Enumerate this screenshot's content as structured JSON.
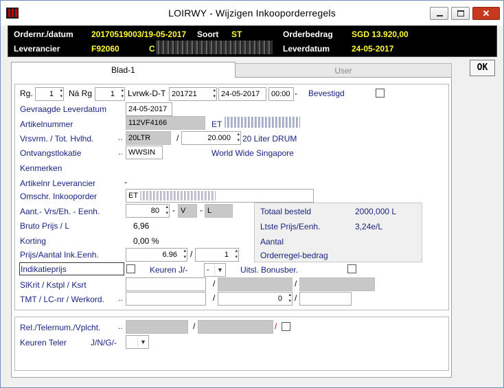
{
  "window": {
    "title": "LOIRWY - Wijzigen Inkooporderregels"
  },
  "header": {
    "order_label": "Ordernr./datum",
    "order_value": "20170519003/19-05-2017",
    "soort_label": "Soort",
    "soort_value": "ST",
    "bedrag_label": "Orderbedrag",
    "bedrag_value": "SGD 13.920,00",
    "lev_label": "Leverancier",
    "lev_value": "F92060",
    "lev_name": "C",
    "leverdatum_label": "Leverdatum",
    "leverdatum_value": "24-05-2017"
  },
  "ok_label": "OK",
  "tabs": [
    {
      "label": "Blad-1"
    },
    {
      "label": "User"
    }
  ],
  "form": {
    "rg_label": "Rg.",
    "rg_value": "1",
    "na_rg_label": "Ná Rg",
    "na_rg_value": "1",
    "lvrwk_label": "Lvrwk-D-T",
    "lvrwk_value": "201721",
    "lvrwk_date": "24-05-2017",
    "lvrwk_time": "00:00",
    "lvrwk_dash": "-",
    "bevestigd_label": "Bevestigd",
    "gevraagde_label": "Gevraagde Leverdatum",
    "gevraagde_value": "24-05-2017",
    "artikelnummer_label": "Artikelnummer",
    "artikelnummer_value": "112VF4166",
    "artikel_desc": "ET",
    "vrsvrm_label": "Vrsvrm. / Tot. Hvlhd.",
    "vrsvrm_value": "20LTR",
    "slash": "/",
    "tot_value": "20.000",
    "vrsvrm_desc": "20 Liter DRUM",
    "ontvangst_label": "Ontvangstlokatie",
    "ontvangst_value": "WWSIN",
    "ontvangst_desc": "World Wide Singapore",
    "kenmerken_label": "Kenmerken",
    "artikelnr_lev_label": "Artikelnr Leverancier",
    "artikelnr_lev_value": "-",
    "omschr_label": "Omschr. Inkooporder",
    "omschr_value": "ET",
    "aant_label": "Aant.- Vrs/Eh. - Eenh.",
    "aant_value": "80",
    "dash": "-",
    "vrs_value": "V",
    "eenh_value": "L",
    "bruto_label": "Bruto Prijs / L",
    "bruto_value": "6,96",
    "korting_label": "Korting",
    "korting_value": "0,00 %",
    "prijs_label": "Prijs/Aantal Ink.Eenh.",
    "prijs_value": "6.96",
    "prijs_aantal": "1",
    "indicatie_label": "Indikatieprijs",
    "keuren_label": "Keuren J/-",
    "keuren_value": "-",
    "uitsl_label": "Uitsl. Bonusber.",
    "slkrit_label": "SlKrit / Kstpl / Ksrt",
    "tmt_label": "TMT / LC-nr / Werkord.",
    "tmt_lc_value": "0",
    "rel_label": "Rel./Telernum./Vplcht.",
    "keuren_teler_label": "Keuren Teler",
    "keuren_teler_opts": "J/N/G/-"
  },
  "summary": {
    "totaal_label": "Totaal besteld",
    "totaal_value": "2000,000 L",
    "ltste_label": "Ltste Prijs/Eenh.",
    "ltste_value": "3,24e/L",
    "aantal_label": "Aantal",
    "orderregel_label": "Orderregel-bedrag"
  },
  "icons": {
    "window": "app-icon",
    "minimize": "minimize-icon",
    "maximize": "maximize-icon",
    "close": "close-icon"
  }
}
